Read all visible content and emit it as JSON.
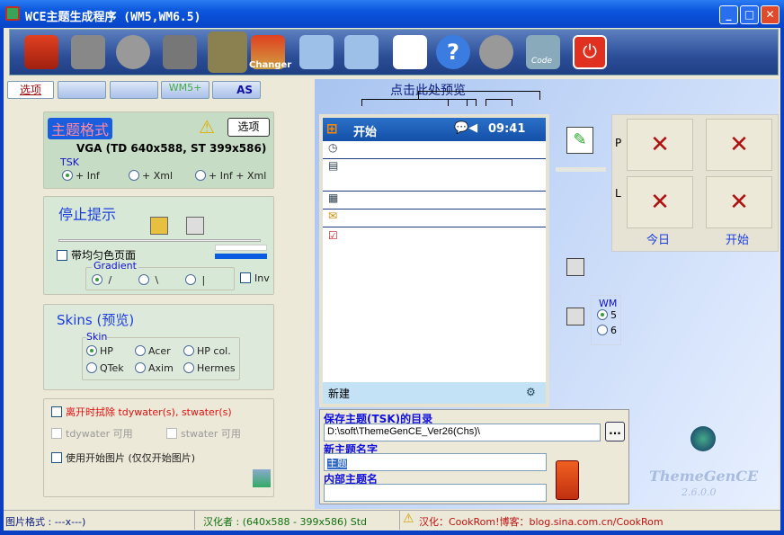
{
  "window": {
    "title": "WCE主题生成程序 (WM5,WM6.5)",
    "min": "_",
    "max": "□",
    "close": "✕"
  },
  "toolbar": {
    "changer_label": "Changer",
    "code_label": "Code"
  },
  "tabs": {
    "options": "选项",
    "as": "AS",
    "wm5": "WM5+"
  },
  "theme_format": {
    "title": "主题格式",
    "options_btn": "选项",
    "resolution": "VGA (TD 640x588, ST 399x586)",
    "tsk_label": "TSK",
    "radios": [
      "+ Inf",
      "+ Xml",
      "+ Inf + Xml"
    ]
  },
  "stop_hint": {
    "title": "停止提示",
    "uniform_page": "带均匀色页面",
    "gradient_label": "Gradient",
    "gradient_opts": [
      "/",
      "\\",
      "|"
    ],
    "inv": "Inv"
  },
  "skins": {
    "title": "Skins (预览)",
    "skin_label": "Skin",
    "options": [
      "HP",
      "Acer",
      "HP col.",
      "QTek",
      "Axim",
      "Hermes"
    ]
  },
  "cleanup": {
    "remove_on_exit": "离开时拭除 tdywater(s), stwater(s)",
    "tdywater": "tdywater 可用",
    "stwater": "stwater 可用",
    "use_start_image": "使用开始图片 (仅仅开始图片)"
  },
  "preview": {
    "hint": "点击此处预览",
    "start": "开始",
    "time": "09:41",
    "new": "新建"
  },
  "tiles": {
    "p": "P",
    "l": "L",
    "today": "今日",
    "start": "开始",
    "wm_label": "WM",
    "wm_opts": [
      "5",
      "6"
    ]
  },
  "save": {
    "dir_label": "保存主题(TSK)的目录",
    "dir_value": "D:\\soft\\ThemeGenCE_Ver26(Chs)\\",
    "browse": "...",
    "name_label": "新主题名字",
    "name_value": "主题",
    "internal_label": "内部主题名",
    "internal_value": ""
  },
  "logo": {
    "name": "ThemeGenCE",
    "version": "2.6.0.0"
  },
  "status": {
    "format": "图片格式 : ---x---)",
    "translator": "汉化者 : (640x588 - 399x586) Std",
    "credit": "汉化：CookRom!博客：blog.sina.com.cn/CookRom"
  }
}
